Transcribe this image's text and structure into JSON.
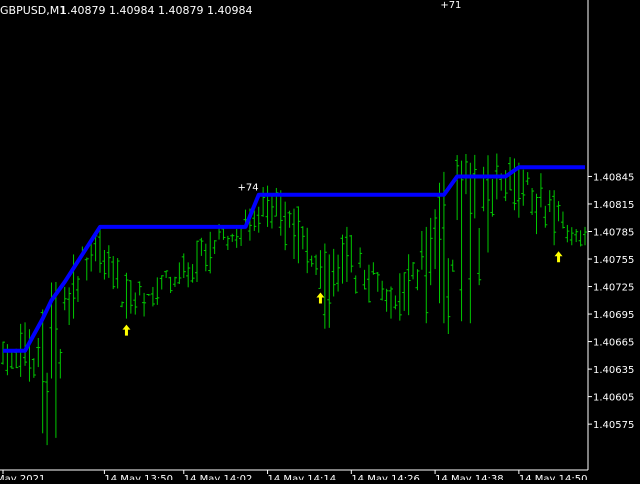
{
  "header": {
    "symbol_info": "GBPUSD,M1",
    "ohlc": "1.40879 1.40984 1.40879 1.40984"
  },
  "colors": {
    "background": "#000000",
    "bars": "#00c800",
    "trail_line": "#0000ff",
    "signal_arrow": "#ffff00",
    "axis_text": "#ffffff",
    "axis_line": "#ffffff"
  },
  "annotations": [
    {
      "text": "+74",
      "x_index": 55,
      "price": 1.40834
    },
    {
      "text": "+71",
      "x_index": 101,
      "price": 1.41033
    }
  ],
  "chart_data": {
    "type": "ohlc-bars",
    "title": "GBPUSD,M1",
    "ylim": [
      1.40525,
      1.41033
    ],
    "yticks": [
      1.40845,
      1.40815,
      1.40785,
      1.40755,
      1.40725,
      1.40695,
      1.40665,
      1.40635,
      1.40605,
      1.40575
    ],
    "xtick_labels": [
      {
        "label": "May 2021",
        "index": 0
      },
      {
        "label": "14 May 13:50",
        "index": 23
      },
      {
        "label": "14 May 14:02",
        "index": 41
      },
      {
        "label": "14 May 14:14",
        "index": 60
      },
      {
        "label": "14 May 14:26",
        "index": 79
      },
      {
        "label": "14 May 14:38",
        "index": 98
      },
      {
        "label": "14 May 14:50",
        "index": 117
      }
    ],
    "bars_count": 133,
    "bar_key_points": [
      {
        "index": 0,
        "low": 1.4064,
        "high": 1.40665
      },
      {
        "index": 9,
        "low": 1.40565,
        "high": 1.407
      },
      {
        "index": 12,
        "low": 1.4056,
        "high": 1.4073
      },
      {
        "index": 16,
        "low": 1.4069,
        "high": 1.4076
      },
      {
        "index": 22,
        "low": 1.4074,
        "high": 1.4079
      },
      {
        "index": 28,
        "low": 1.4069,
        "high": 1.4074
      },
      {
        "index": 35,
        "low": 1.40705,
        "high": 1.40735
      },
      {
        "index": 44,
        "low": 1.4073,
        "high": 1.40775
      },
      {
        "index": 56,
        "low": 1.40775,
        "high": 1.4081
      },
      {
        "index": 60,
        "low": 1.4079,
        "high": 1.40835
      },
      {
        "index": 66,
        "low": 1.40755,
        "high": 1.4081
      },
      {
        "index": 74,
        "low": 1.4068,
        "high": 1.4076
      },
      {
        "index": 78,
        "low": 1.4073,
        "high": 1.4079
      },
      {
        "index": 88,
        "low": 1.4069,
        "high": 1.40725
      },
      {
        "index": 96,
        "low": 1.40685,
        "high": 1.4079
      },
      {
        "index": 100,
        "low": 1.40685,
        "high": 1.4085
      },
      {
        "index": 106,
        "low": 1.40685,
        "high": 1.4086
      },
      {
        "index": 112,
        "low": 1.4082,
        "high": 1.4087
      },
      {
        "index": 117,
        "low": 1.408,
        "high": 1.4086
      },
      {
        "index": 125,
        "low": 1.4077,
        "high": 1.4083
      },
      {
        "index": 132,
        "low": 1.4077,
        "high": 1.4079
      }
    ],
    "trail_line": [
      {
        "index": 0,
        "value": 1.40655
      },
      {
        "index": 5,
        "value": 1.40655
      },
      {
        "index": 9,
        "value": 1.4069
      },
      {
        "index": 11,
        "value": 1.4071
      },
      {
        "index": 14,
        "value": 1.4073
      },
      {
        "index": 18,
        "value": 1.4076
      },
      {
        "index": 22,
        "value": 1.4079
      },
      {
        "index": 55,
        "value": 1.4079
      },
      {
        "index": 58,
        "value": 1.40825
      },
      {
        "index": 100,
        "value": 1.40825
      },
      {
        "index": 103,
        "value": 1.40845
      },
      {
        "index": 114,
        "value": 1.40845
      },
      {
        "index": 117,
        "value": 1.40855
      },
      {
        "index": 132,
        "value": 1.40855
      }
    ],
    "signals": [
      {
        "index": 28,
        "price": 1.4069,
        "type": "buy-arrow"
      },
      {
        "index": 72,
        "price": 1.40725,
        "type": "buy-arrow"
      },
      {
        "index": 126,
        "price": 1.4077,
        "type": "buy-arrow"
      }
    ]
  }
}
